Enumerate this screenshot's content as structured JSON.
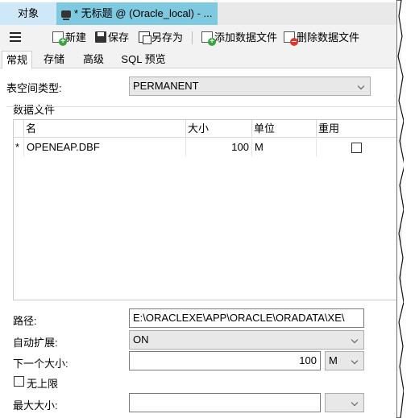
{
  "tabs": {
    "object_tab": "对象",
    "document_tab": "* 无标题 @ (Oracle_local) - ..."
  },
  "toolbar": {
    "new": "新建",
    "save": "保存",
    "save_as": "另存为",
    "add_datafile": "添加数据文件",
    "delete_datafile": "删除数据文件"
  },
  "subtabs": [
    "常规",
    "存储",
    "高级",
    "SQL 预览"
  ],
  "form": {
    "tablespace_type_label": "表空间类型:",
    "tablespace_type_value": "PERMANENT",
    "datafiles_group": "数据文件",
    "path_label": "路径:",
    "path_value": "E:\\ORACLEXE\\APP\\ORACLE\\ORADATA\\XE\\",
    "autoextend_label": "自动扩展:",
    "autoextend_value": "ON",
    "next_size_label": "下一个大小:",
    "next_size_value": "100",
    "next_size_unit": "M",
    "unlimited_label": "无上限",
    "max_size_label": "最大大小:",
    "max_size_value": "",
    "max_size_unit": ""
  },
  "datafile_table": {
    "columns": [
      "名",
      "大小",
      "单位",
      "重用"
    ],
    "rows": [
      {
        "marker": "*",
        "name": "OPENEAP.DBF",
        "size": "100",
        "unit": "M",
        "reuse": false
      }
    ]
  },
  "colors": {
    "active_doc_tab": "#7ec8e0",
    "object_tab": "#cfe8f8",
    "toolbar_bg": "#f2f2f2",
    "add_green": "#3aa540",
    "delete_red": "#d83a2c"
  }
}
